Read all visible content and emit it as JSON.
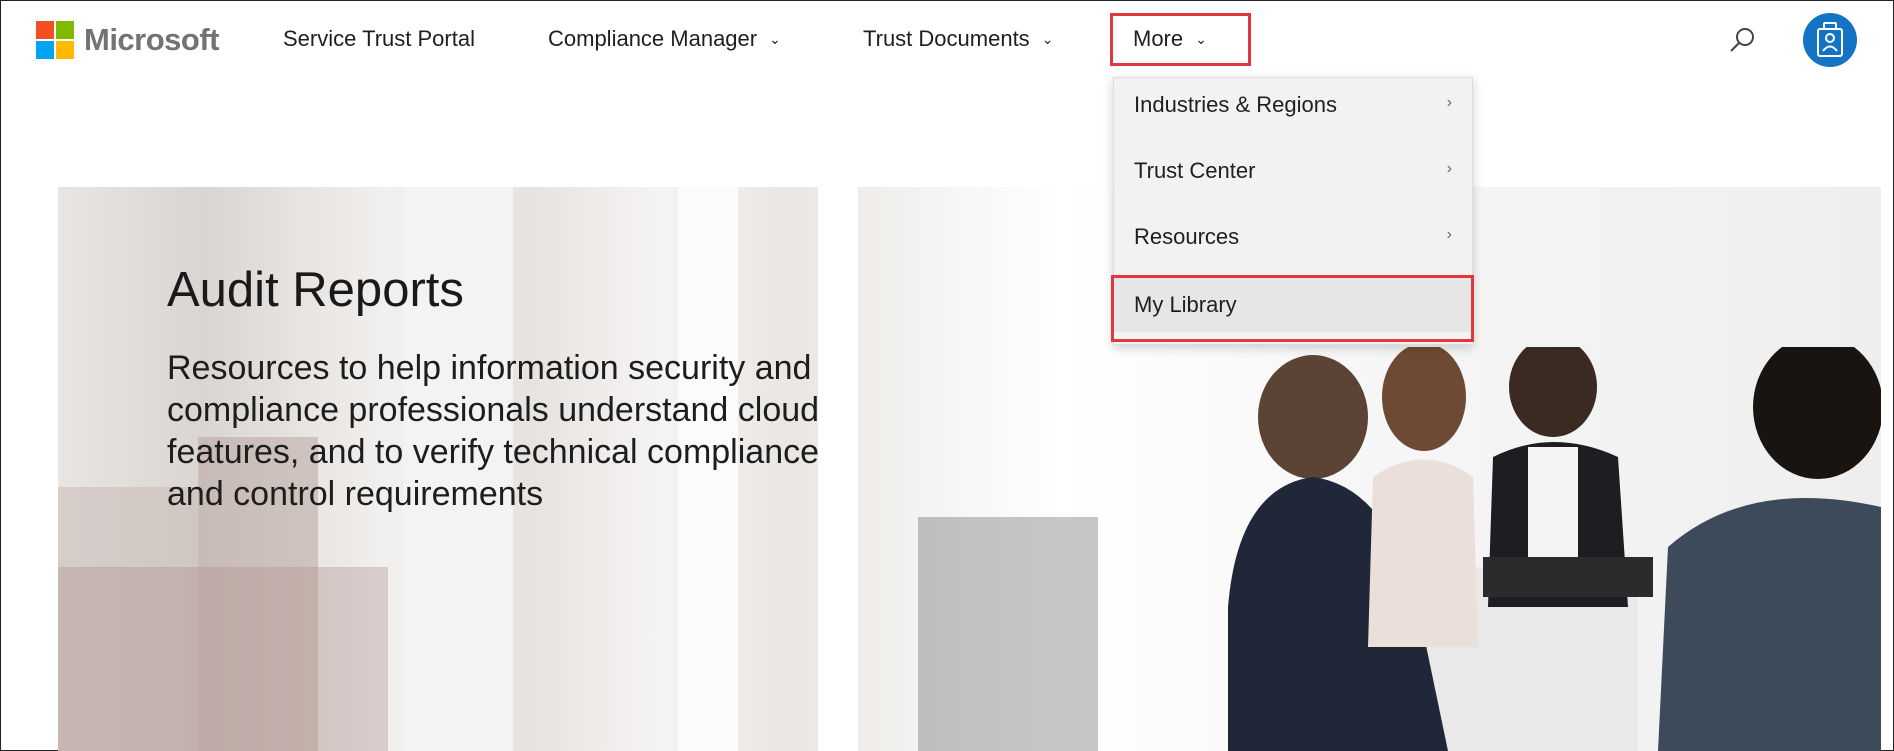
{
  "brand": {
    "name": "Microsoft",
    "colors": [
      "#f25022",
      "#7fba00",
      "#00a4ef",
      "#ffb900"
    ]
  },
  "nav": {
    "items": [
      {
        "label": "Service Trust Portal"
      },
      {
        "label": "Compliance Manager",
        "icon": "chevron-down-icon"
      },
      {
        "label": "Trust Documents",
        "icon": "chevron-down-icon"
      },
      {
        "label": "More",
        "icon": "chevron-down-icon",
        "highlighted": true
      }
    ],
    "search_icon": "search-icon",
    "avatar_icon": "badge-icon"
  },
  "dropdown": {
    "items": [
      {
        "label": "Industries & Regions",
        "icon": "chevron-right-icon"
      },
      {
        "label": "Trust Center",
        "icon": "chevron-right-icon"
      },
      {
        "label": "Resources",
        "icon": "chevron-right-icon"
      },
      {
        "label": "My Library",
        "highlighted": true
      }
    ]
  },
  "hero": {
    "title": "Audit Reports",
    "description": "Resources to help information security and compliance professionals understand cloud features, and to verify technical compliance and control requirements"
  },
  "colors": {
    "highlight_border": "#e0383e",
    "avatar_bg": "#1473c4",
    "dropdown_bg": "#f2f2f2"
  }
}
